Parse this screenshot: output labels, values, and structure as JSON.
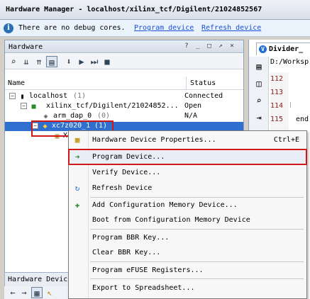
{
  "window": {
    "title": "Hardware Manager - localhost/xilinx_tcf/Digilent/21024852567"
  },
  "infobar": {
    "message": "There are no debug cores.",
    "program_link": "Program device",
    "refresh_link": "Refresh device"
  },
  "hardware_panel": {
    "title": "Hardware",
    "controls": [
      "?",
      "_",
      "□",
      "↗",
      "×"
    ],
    "columns": {
      "name": "Name",
      "status": "Status"
    },
    "tree": [
      {
        "name": "localhost",
        "count": "(1)",
        "status": "Connected"
      },
      {
        "name": "xilinx_tcf/Digilent/21024852...",
        "status": "Open"
      },
      {
        "name": "arm_dap_0",
        "count": "(0)",
        "status": "N/A"
      },
      {
        "name": "xc7z020_1",
        "count": "(1)",
        "status": ""
      },
      {
        "name": "X",
        "status": ""
      }
    ]
  },
  "bottom_tab": {
    "label": "Hardware Devic"
  },
  "editor": {
    "tab": "Divider_",
    "path": "D:/Worksp",
    "lines": [
      {
        "num": "112",
        "code": ""
      },
      {
        "num": "113",
        "code": ""
      },
      {
        "num": "114",
        "code": ""
      },
      {
        "num": "115",
        "code": "end"
      }
    ]
  },
  "context_menu": {
    "items": [
      {
        "label": "Hardware Device Properties...",
        "shortcut": "Ctrl+E",
        "icon": "properties-icon"
      },
      {
        "label": "Program Device...",
        "shortcut": "",
        "icon": "program-icon"
      },
      {
        "label": "Verify Device...",
        "shortcut": "",
        "icon": ""
      },
      {
        "label": "Refresh Device",
        "shortcut": "",
        "icon": "refresh-icon"
      },
      {
        "label": "Add Configuration Memory Device...",
        "shortcut": "",
        "icon": "add-memory-icon"
      },
      {
        "label": "Boot from Configuration Memory Device",
        "shortcut": "",
        "icon": ""
      },
      {
        "label": "Program BBR Key...",
        "shortcut": "",
        "icon": ""
      },
      {
        "label": "Clear BBR Key...",
        "shortcut": "",
        "icon": ""
      },
      {
        "label": "Program eFUSE Registers...",
        "shortcut": "",
        "icon": ""
      },
      {
        "label": "Export to Spreadsheet...",
        "shortcut": "",
        "icon": ""
      }
    ]
  },
  "colors": {
    "selection": "#2f6fd0",
    "highlight_box": "#d01818",
    "link": "#1a4fd6"
  }
}
